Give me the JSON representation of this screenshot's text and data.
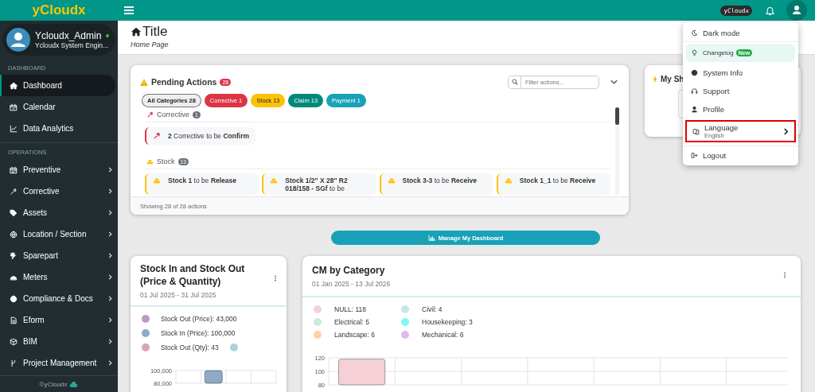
{
  "topbar": {
    "logo": "yCloudx",
    "brand_badge": "yCloudx"
  },
  "sidebar": {
    "user": {
      "name": "Ycloudx_Admin",
      "role": "Ycloudx System Engin...",
      "online": true
    },
    "sections": [
      {
        "heading": "DASHBOARD",
        "items": [
          {
            "label": "Dashboard",
            "selected": true,
            "expandable": false
          },
          {
            "label": "Calendar",
            "selected": false,
            "expandable": false
          },
          {
            "label": "Data Analytics",
            "selected": false,
            "expandable": false
          }
        ]
      },
      {
        "heading": "OPERATIONS",
        "items": [
          {
            "label": "Preventive",
            "selected": false,
            "expandable": true
          },
          {
            "label": "Corrective",
            "selected": false,
            "expandable": true
          },
          {
            "label": "Assets",
            "selected": false,
            "expandable": true
          },
          {
            "label": "Location / Section",
            "selected": false,
            "expandable": true
          },
          {
            "label": "Sparepart",
            "selected": false,
            "expandable": true
          },
          {
            "label": "Meters",
            "selected": false,
            "expandable": true
          },
          {
            "label": "Compliance & Docs",
            "selected": false,
            "expandable": true
          },
          {
            "label": "Eform",
            "selected": false,
            "expandable": true
          },
          {
            "label": "BIM",
            "selected": false,
            "expandable": true
          },
          {
            "label": "Project Management",
            "selected": false,
            "expandable": true
          }
        ]
      }
    ],
    "footer": "©yCloudx"
  },
  "header": {
    "title": "Title",
    "subtitle": "Home Page"
  },
  "pending_actions": {
    "title": "Pending Actions",
    "count": "28",
    "search": {
      "placeholder": "Filter actions..."
    },
    "filters": [
      {
        "label": "All Categories 28",
        "selected": true,
        "color": "#eeeeee"
      },
      {
        "label": "Corrective 1",
        "selected": false,
        "color": "#dc3545"
      },
      {
        "label": "Stock 13",
        "selected": false,
        "color": "#ffc107"
      },
      {
        "label": "Claim 13",
        "selected": false,
        "color": "#00897b"
      },
      {
        "label": "Payment 1",
        "selected": false,
        "color": "#17a2b8"
      }
    ],
    "groups": [
      {
        "kind": "corrective",
        "name": "Corrective",
        "count": "1",
        "color": "#dc3545",
        "items": [
          {
            "text": "**2** Corrective to be **Confirm**"
          }
        ]
      },
      {
        "kind": "stock",
        "name": "Stock",
        "count": "13",
        "color": "#ffc107",
        "items": [
          {
            "text": "**Stock 1** to be **Release**"
          },
          {
            "text": "**Stock 1/2\" X 28\" R2 018/158 - SGf** to be"
          },
          {
            "text": "**Stock 3-3** to be **Receive**"
          },
          {
            "text": "**Stock 1_1** to be **Receive**"
          }
        ]
      }
    ],
    "footer": "Showing 28 of 28 actions"
  },
  "shortcuts_card": {
    "title": "My Sh"
  },
  "manage_button": "Manage My Dashboard",
  "charts": [
    {
      "title": "Stock In and Stock Out (Price & Quantity)",
      "date_range": "01 Jul 2025 - 31 Jul 2025",
      "legend": [
        {
          "label": "Stock Out (Price): 43,000",
          "color": "#b99bc8"
        },
        {
          "label": "Stock In (Price): 100,000",
          "color": "#8fa9c9"
        },
        {
          "label": "Stock Out (Qty): 43",
          "color": "#d4a6b6"
        },
        {
          "color": "#a9d3d8"
        }
      ],
      "chart_data": {
        "type": "bar",
        "values": [
          null,
          100000,
          null,
          null
        ],
        "ylim": [
          80000,
          100000
        ],
        "yticks": [
          {
            "value": 80000,
            "label": "80,000"
          },
          {
            "value": 100000,
            "label": "100,000"
          }
        ]
      }
    },
    {
      "title": "CM by Category",
      "date_range": "01 Jan 2025 - 13 Jul 2026",
      "legend": [
        {
          "label": "NULL: 118",
          "color": "#f5d0d6"
        },
        {
          "label": "Civil: 4",
          "color": "#c7e6ea"
        },
        {
          "label": "Electrical: 5",
          "color": "#cdebd7"
        },
        {
          "label": "Housekeeping: 3",
          "color": "#80fbf2"
        },
        {
          "label": "Landscape: 6",
          "color": "#ffd0a8"
        },
        {
          "label": "Mechanical: 6",
          "color": "#e3b8ee"
        }
      ],
      "chart_data": {
        "type": "bar",
        "values": [
          118
        ],
        "ylim": [
          80,
          120
        ],
        "yticks": [
          80,
          100,
          120
        ]
      }
    }
  ],
  "user_menu": {
    "items": [
      {
        "kind": "item",
        "label": "Dark mode",
        "outlined": false
      },
      {
        "kind": "featured",
        "label": "Changelog",
        "badge": "New",
        "outlined": false
      },
      {
        "kind": "item",
        "label": "System Info",
        "outlined": false
      },
      {
        "kind": "item",
        "label": "Support",
        "outlined": false
      },
      {
        "kind": "item",
        "label": "Profile",
        "outlined": false
      },
      {
        "kind": "submenu",
        "label": "Language",
        "sublabel": "English",
        "outlined": true
      },
      {
        "kind": "item",
        "label": "Logout",
        "outlined": false
      }
    ]
  }
}
